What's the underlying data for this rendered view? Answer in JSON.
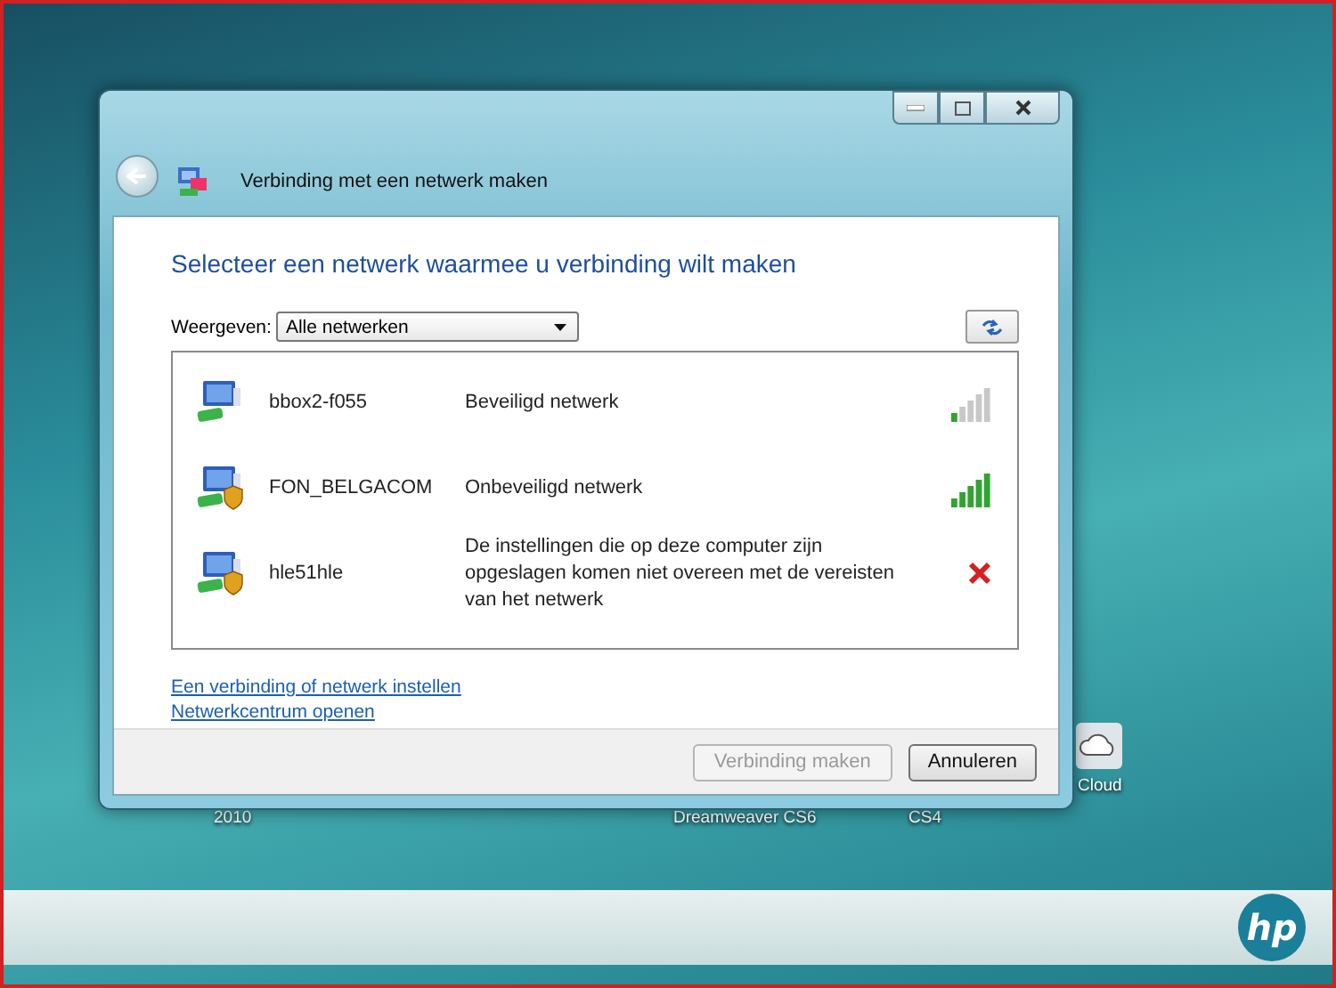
{
  "desktop": {
    "icon_labels": [
      {
        "text": "2010"
      },
      {
        "text": "Dreamweaver CS6"
      },
      {
        "text": "CS4"
      }
    ],
    "cloud_label": "Cloud",
    "logo": "hp"
  },
  "window": {
    "title": "Verbinding met een netwerk maken",
    "heading": "Selecteer een netwerk waarmee u verbinding wilt maken",
    "filter": {
      "label": "Weergeven:",
      "value": "Alle netwerken"
    },
    "networks": [
      {
        "name": "bbox2-f055",
        "status": "Beveiligd netwerk",
        "shield": false,
        "kind": "signal",
        "level": 0.2
      },
      {
        "name": "FON_BELGACOM",
        "status": "Onbeveiligd netwerk",
        "shield": true,
        "kind": "signal",
        "level": 1
      },
      {
        "name": "hle51hle",
        "status": "De instellingen die op deze computer zijn opgeslagen komen niet overeen met de vereisten van het netwerk",
        "shield": true,
        "kind": "error"
      }
    ],
    "links": [
      "Een verbinding of netwerk instellen",
      "Netwerkcentrum openen"
    ],
    "buttons": [
      {
        "label": "Verbinding maken",
        "disabled": true
      },
      {
        "label": "Annuleren",
        "disabled": false
      }
    ]
  }
}
